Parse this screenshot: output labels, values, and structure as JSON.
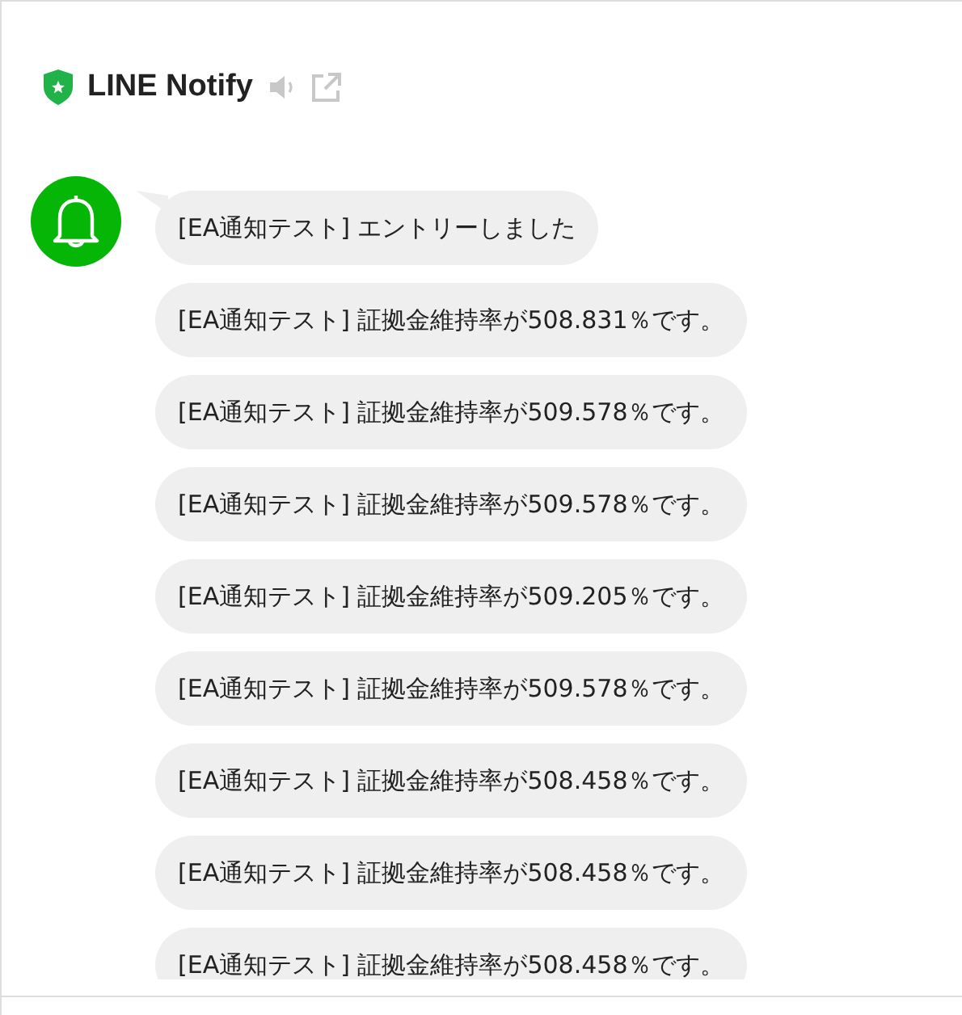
{
  "header": {
    "title": "LINE Notify"
  },
  "messages": [
    {
      "text": "[EA通知テスト] エントリーしました"
    },
    {
      "text": "[EA通知テスト] 証拠金維持率が508.831％です。"
    },
    {
      "text": "[EA通知テスト] 証拠金維持率が509.578％です。"
    },
    {
      "text": "[EA通知テスト] 証拠金維持率が509.578％です。"
    },
    {
      "text": "[EA通知テスト] 証拠金維持率が509.205％です。"
    },
    {
      "text": "[EA通知テスト] 証拠金維持率が509.578％です。"
    },
    {
      "text": "[EA通知テスト] 証拠金維持率が508.458％です。"
    },
    {
      "text": "[EA通知テスト] 証拠金維持率が508.458％です。"
    },
    {
      "text": "[EA通知テスト] 証拠金維持率が508.458％です。"
    }
  ]
}
